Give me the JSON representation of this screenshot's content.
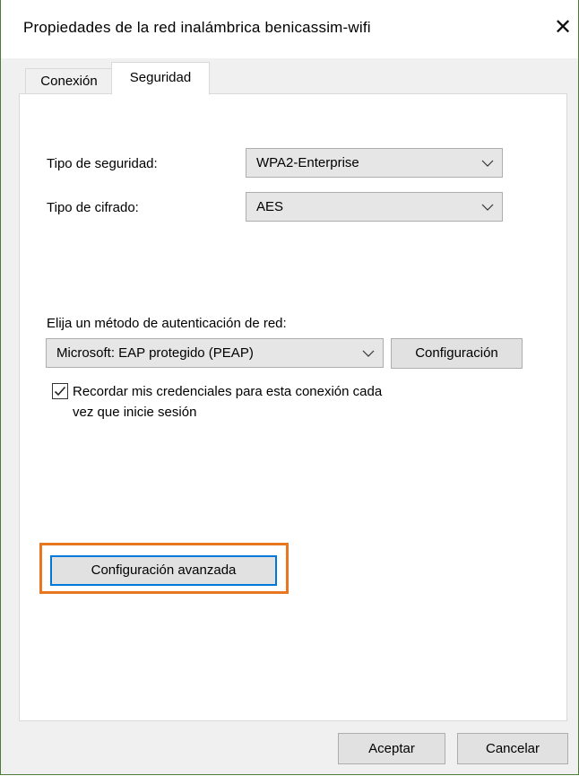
{
  "window": {
    "title": "Propiedades de la red inalámbrica benicassim-wifi",
    "close_glyph": "✕"
  },
  "tabs": [
    {
      "label": "Conexión",
      "active": false
    },
    {
      "label": "Seguridad",
      "active": true
    }
  ],
  "security": {
    "type_label": "Tipo de seguridad:",
    "type_value": "WPA2-Enterprise",
    "cipher_label": "Tipo de cifrado:",
    "cipher_value": "AES"
  },
  "auth": {
    "label": "Elija un método de autenticación de red:",
    "method_value": "Microsoft: EAP protegido (PEAP)",
    "settings_button": "Configuración",
    "remember_checked": true,
    "remember_line1": "Recordar mis credenciales para esta conexión cada",
    "remember_line2": "vez que inicie sesión"
  },
  "advanced": {
    "button": "Configuración avanzada",
    "highlight_color": "#e87722",
    "focus_color": "#0078d7"
  },
  "footer": {
    "ok": "Aceptar",
    "cancel": "Cancelar"
  },
  "icons": [
    "close-icon",
    "chevron-down-icon",
    "checkmark-icon"
  ]
}
